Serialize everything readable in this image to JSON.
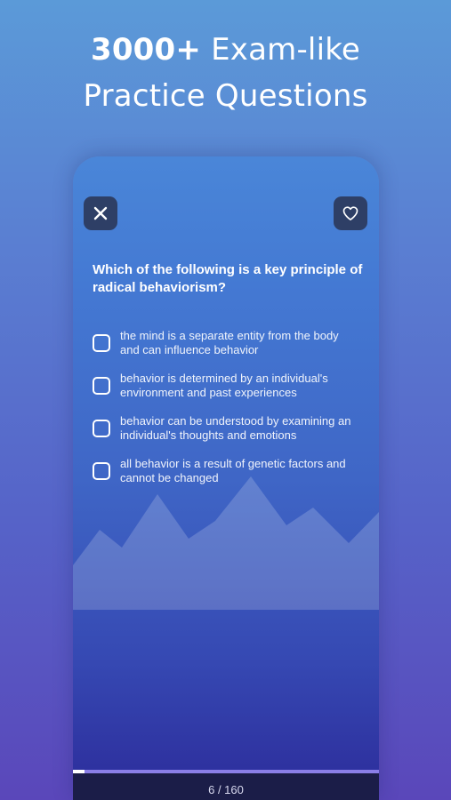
{
  "headline": {
    "strong": "3000+",
    "rest_line1": " Exam-like",
    "line2": "Practice Questions"
  },
  "toolbar": {
    "close_icon": "close-icon",
    "favorite_icon": "heart-icon"
  },
  "quiz": {
    "question": "Which of the following is a key principle of radical behaviorism?",
    "options": [
      {
        "text": "the mind is a separate entity from the body and can influence behavior",
        "checked": false
      },
      {
        "text": "behavior is determined by an individual's environment and past experiences",
        "checked": false
      },
      {
        "text": "behavior can be understood by examining an individual's thoughts and emotions",
        "checked": false
      },
      {
        "text": "all behavior is a result of genetic factors and cannot be changed",
        "checked": false
      }
    ]
  },
  "progress": {
    "current": 6,
    "total": 160,
    "label": "6 / 160"
  },
  "colors": {
    "accent_track": "#8a7ee8",
    "footer_bg": "#1b1d48",
    "button_bg": "#2e3f66"
  }
}
